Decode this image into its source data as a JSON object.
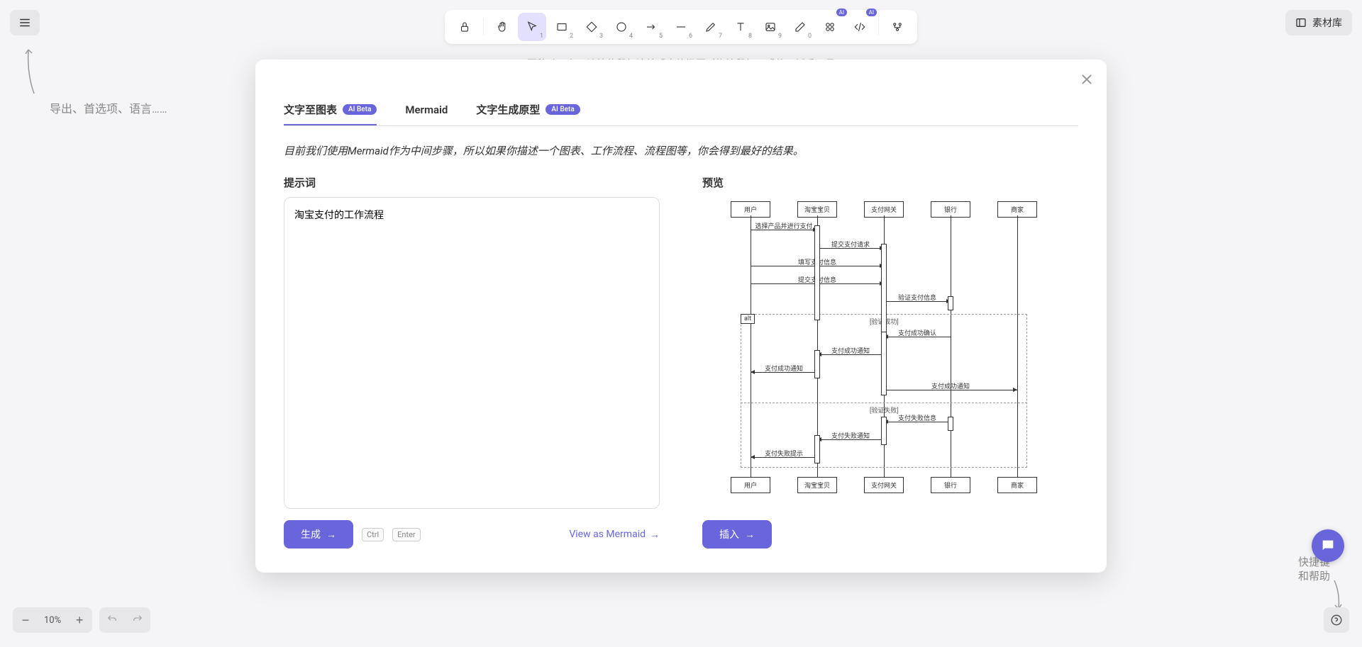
{
  "toolbar": {
    "library": "素材库"
  },
  "canvas": {
    "hint": "要移动画布，请按住鼠标滚轮或空格键同时拖拽鼠标，或使用抓手工具",
    "exportHint": "导出、首选项、语言……",
    "helpHint1": "快捷键",
    "helpHint2": "和帮助"
  },
  "zoom": {
    "level": "10%"
  },
  "modal": {
    "tabs": {
      "t1": "文字至图表",
      "t2": "Mermaid",
      "t3": "文字生成原型",
      "beta": "AI Beta"
    },
    "desc": "目前我们使用Mermaid作为中间步骤，所以如果你描述一个图表、工作流程、流程图等，你会得到最好的结果。",
    "promptLabel": "提示词",
    "promptValue": "淘宝支付的工作流程",
    "previewLabel": "预览",
    "generate": "生成",
    "kbd1": "Ctrl",
    "kbd2": "Enter",
    "viewMermaid": "View as Mermaid",
    "insert": "插入"
  },
  "diagram": {
    "participants": [
      "用户",
      "淘宝宝贝",
      "支付网关",
      "银行",
      "商家"
    ],
    "messages": [
      "选择产品并进行支付",
      "提交支付请求",
      "填写支付信息",
      "提交支付信息",
      "验证支付信息",
      "支付成功确认",
      "支付成功通知",
      "支付成功通知",
      "支付成功通知",
      "支付失败信息",
      "支付失败通知",
      "支付失败提示"
    ],
    "alt": {
      "label": "alt",
      "cond1": "[验证成功]",
      "cond2": "[验证失败]"
    }
  }
}
